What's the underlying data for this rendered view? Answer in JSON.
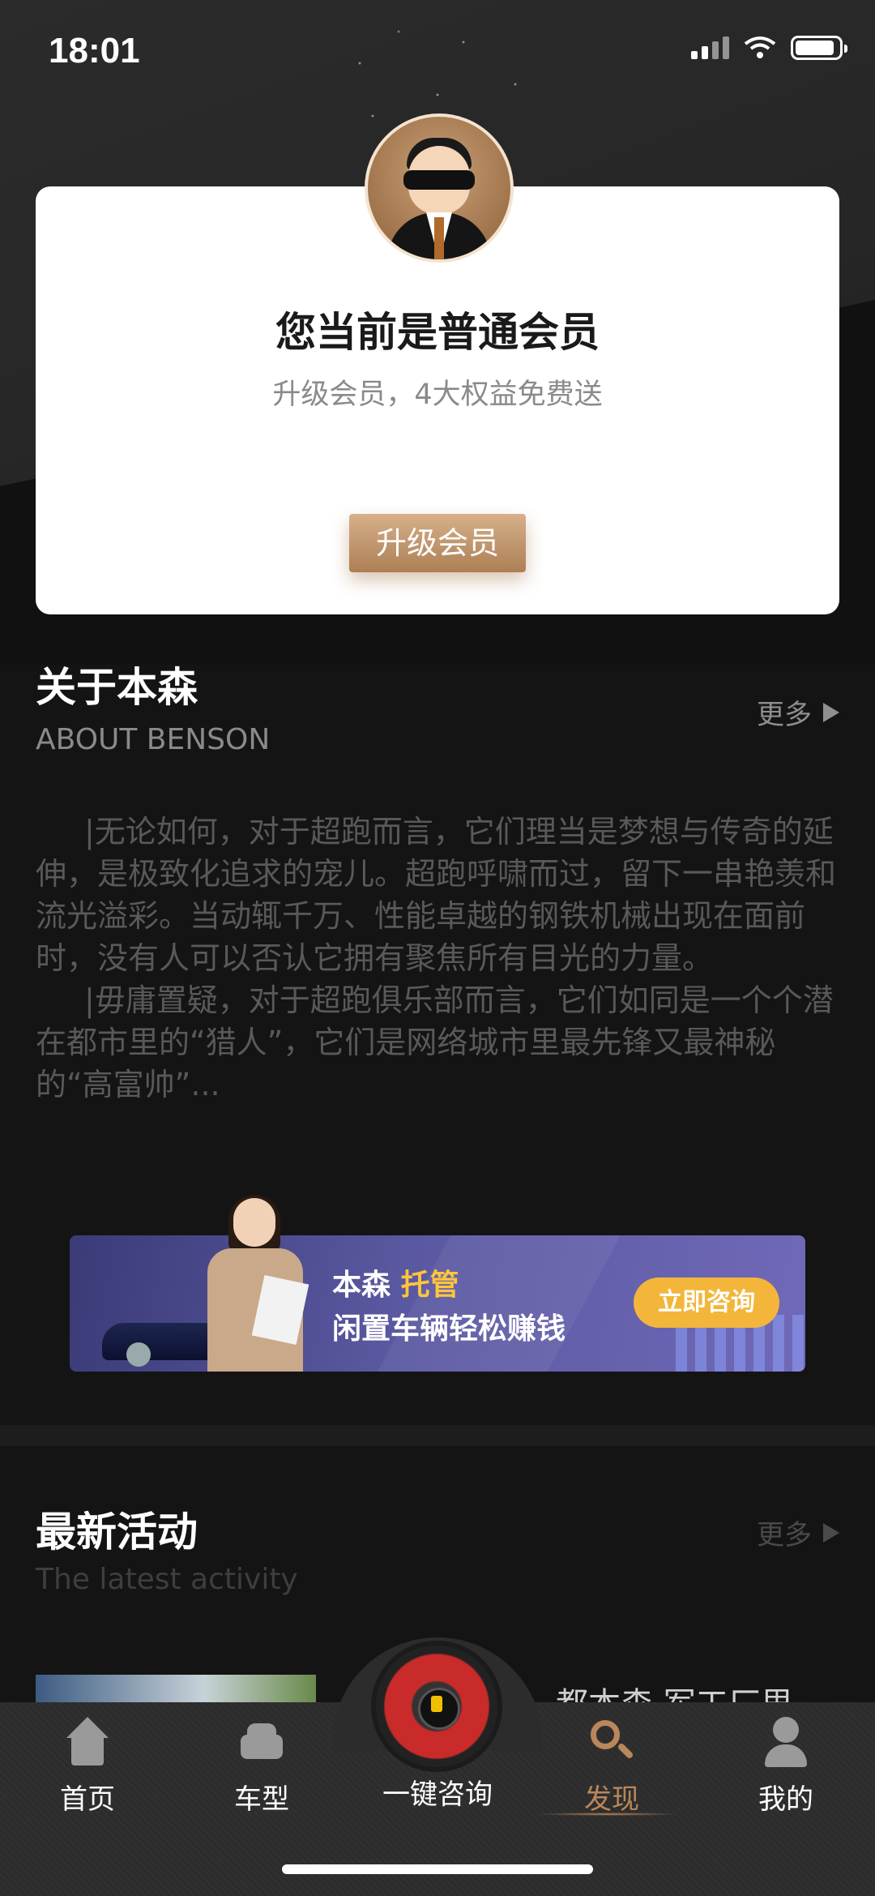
{
  "status_bar": {
    "time": "18:01"
  },
  "member_card": {
    "title": "您当前是普通会员",
    "subtitle": "升级会员，4大权益免费送",
    "upgrade_button": "升级会员"
  },
  "about": {
    "title": "关于本森",
    "subtitle": "ABOUT BENSON",
    "more": "更多",
    "paragraph1": "|无论如何，对于超跑而言，它们理当是梦想与传奇的延伸，是极致化追求的宠儿。超跑呼啸而过，留下一串艳羡和流光溢彩。当动辄千万、性能卓越的钢铁机械出现在面前时，没有人可以否认它拥有聚焦所有目光的力量。",
    "paragraph2": "|毋庸置疑，对于超跑俱乐部而言，它们如同是一个个潜在都市里的“猎人”，它们是网络城市里最先锋又最神秘的“高富帅”..."
  },
  "banner": {
    "brand": "本森",
    "highlight": "托管",
    "line2": "闲置车辆轻松赚钱",
    "button": "立即咨询"
  },
  "activity": {
    "title": "最新活动",
    "subtitle": "The latest activity",
    "more": "更多",
    "item_title_partial": "都本森 军工厂里"
  },
  "tabbar": {
    "tabs": [
      {
        "label": "首页",
        "icon": "home-icon"
      },
      {
        "label": "车型",
        "icon": "car-icon"
      },
      {
        "label": "一键咨询",
        "icon": "steering-wheel-icon"
      },
      {
        "label": "发现",
        "icon": "search-icon",
        "active": true
      },
      {
        "label": "我的",
        "icon": "user-icon"
      }
    ]
  },
  "colors": {
    "accent": "#b9875a",
    "banner_highlight": "#ffc53d",
    "consult_button": "#f3b63a"
  }
}
